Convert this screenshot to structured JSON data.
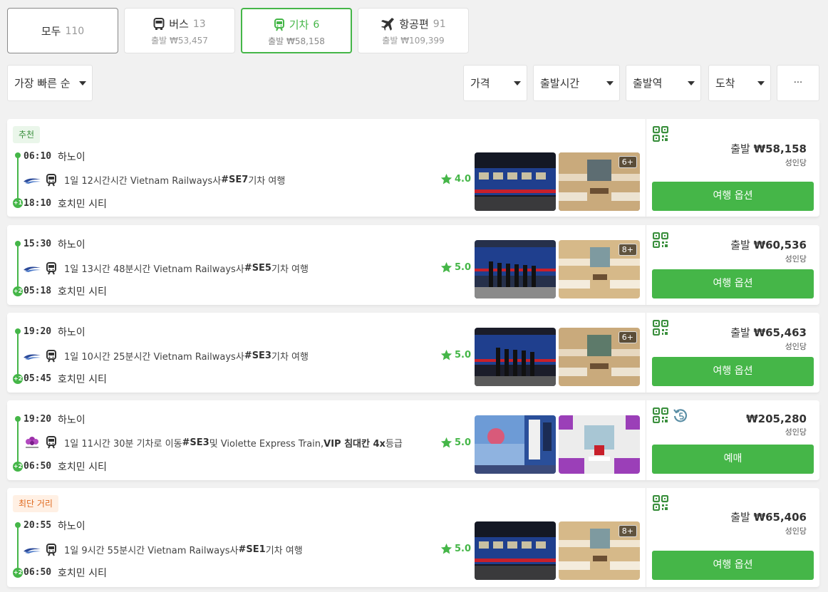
{
  "tabs": [
    {
      "label": "모두",
      "count": "110"
    },
    {
      "label": "버스",
      "count": "13",
      "from": "출발 ₩53,457"
    },
    {
      "label": "기차",
      "count": "6",
      "from": "출발 ₩58,158"
    },
    {
      "label": "항공편",
      "count": "91",
      "from": "출발 ₩109,399"
    }
  ],
  "filters": {
    "sort": "가장 빠른 순",
    "price": "가격",
    "departure_time": "출발시간",
    "departure_station": "출발역",
    "arrival": "도착",
    "more": "···"
  },
  "accent_color": "#45b648",
  "trips": [
    {
      "badge": "추천",
      "dep_time": "06:10",
      "dep_city": "하노이",
      "arr_time": "18:10",
      "arr_city": "호치민 시티",
      "day_offset": "+1",
      "desc_pre": "1일 12시간시간 Vietnam Railways사 ",
      "code": "#SE7",
      "desc_post": "기차 여행",
      "rating": "4.0",
      "photo_count": "6+",
      "price_prefix": "출발 ",
      "price": "₩58,158",
      "per": "성인당",
      "cta": "여행 옵션"
    },
    {
      "dep_time": "15:30",
      "dep_city": "하노이",
      "arr_time": "05:18",
      "arr_city": "호치민 시티",
      "day_offset": "+2",
      "desc_pre": "1일 13시간 48분시간 Vietnam Railways사 ",
      "code": "#SE5",
      "desc_post": "기차 여행",
      "rating": "5.0",
      "photo_count": "8+",
      "price_prefix": "출발 ",
      "price": "₩60,536",
      "per": "성인당",
      "cta": "여행 옵션"
    },
    {
      "dep_time": "19:20",
      "dep_city": "하노이",
      "arr_time": "05:45",
      "arr_city": "호치민 시티",
      "day_offset": "+2",
      "desc_pre": "1일 10시간 25분시간 Vietnam Railways사 ",
      "code": "#SE3",
      "desc_post": "기차 여행",
      "rating": "5.0",
      "photo_count": "6+",
      "price_prefix": "출발 ",
      "price": "₩65,463",
      "per": "성인당",
      "cta": "여행 옵션"
    },
    {
      "dep_time": "19:20",
      "dep_city": "하노이",
      "arr_time": "06:50",
      "arr_city": "호치민 시티",
      "day_offset": "+2",
      "desc_pre": "1일 11시간 30분 기차로 이동 ",
      "code": "#SE3",
      "desc_mid": " 및 Violette Express Train, ",
      "vip": "VIP 침대칸 4x",
      "desc_post": " 등급",
      "rating": "5.0",
      "price_prefix": "",
      "price": "₩205,280",
      "per": "성인당",
      "cta": "예매"
    },
    {
      "badge": "최단 거리",
      "dep_time": "20:55",
      "dep_city": "하노이",
      "arr_time": "06:50",
      "arr_city": "호치민 시티",
      "day_offset": "+2",
      "desc_pre": "1일 9시간 55분시간 Vietnam Railways사 ",
      "code": "#SE1",
      "desc_post": "기차 여행",
      "rating": "5.0",
      "photo_count": "8+",
      "price_prefix": "출발 ",
      "price": "₩65,406",
      "per": "성인당",
      "cta": "여행 옵션"
    }
  ]
}
